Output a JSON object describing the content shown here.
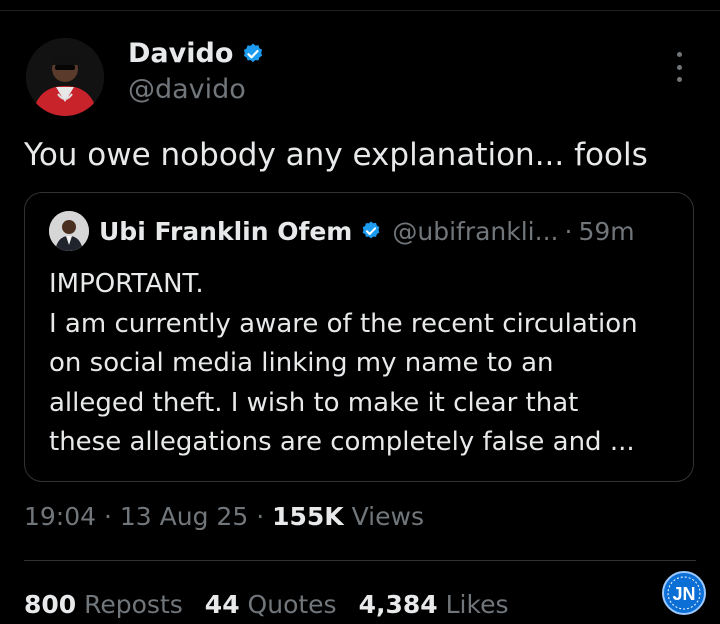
{
  "author": {
    "display_name": "Davido",
    "handle": "@davido",
    "verified_icon": "verified-badge-icon"
  },
  "tweet": {
    "text": "You owe nobody any explanation... fools"
  },
  "quoted_tweet": {
    "display_name": "Ubi Franklin Ofem",
    "handle": "@ubifrankli...",
    "separator": "·",
    "time": "59m",
    "lines": [
      "IMPORTANT.",
      "I am currently aware of the recent circulation",
      "on social media linking my name to an",
      "alleged theft. I wish to make it clear that",
      "these allegations are completely false and ..."
    ]
  },
  "meta": {
    "time": "19:04",
    "sep1": "·",
    "date": "13 Aug 25",
    "sep2": "·",
    "views_count": "155K",
    "views_label": "Views"
  },
  "stats": {
    "reposts_count": "800",
    "reposts_label": "Reposts",
    "quotes_count": "44",
    "quotes_label": "Quotes",
    "likes_count": "4,384",
    "likes_label": "Likes"
  },
  "watermark": {
    "text": "JN"
  },
  "colors": {
    "background": "#000000",
    "text_primary": "#e7e9ea",
    "text_secondary": "#71767b",
    "verified_blue": "#1d9bf0",
    "border": "#2f3336"
  }
}
